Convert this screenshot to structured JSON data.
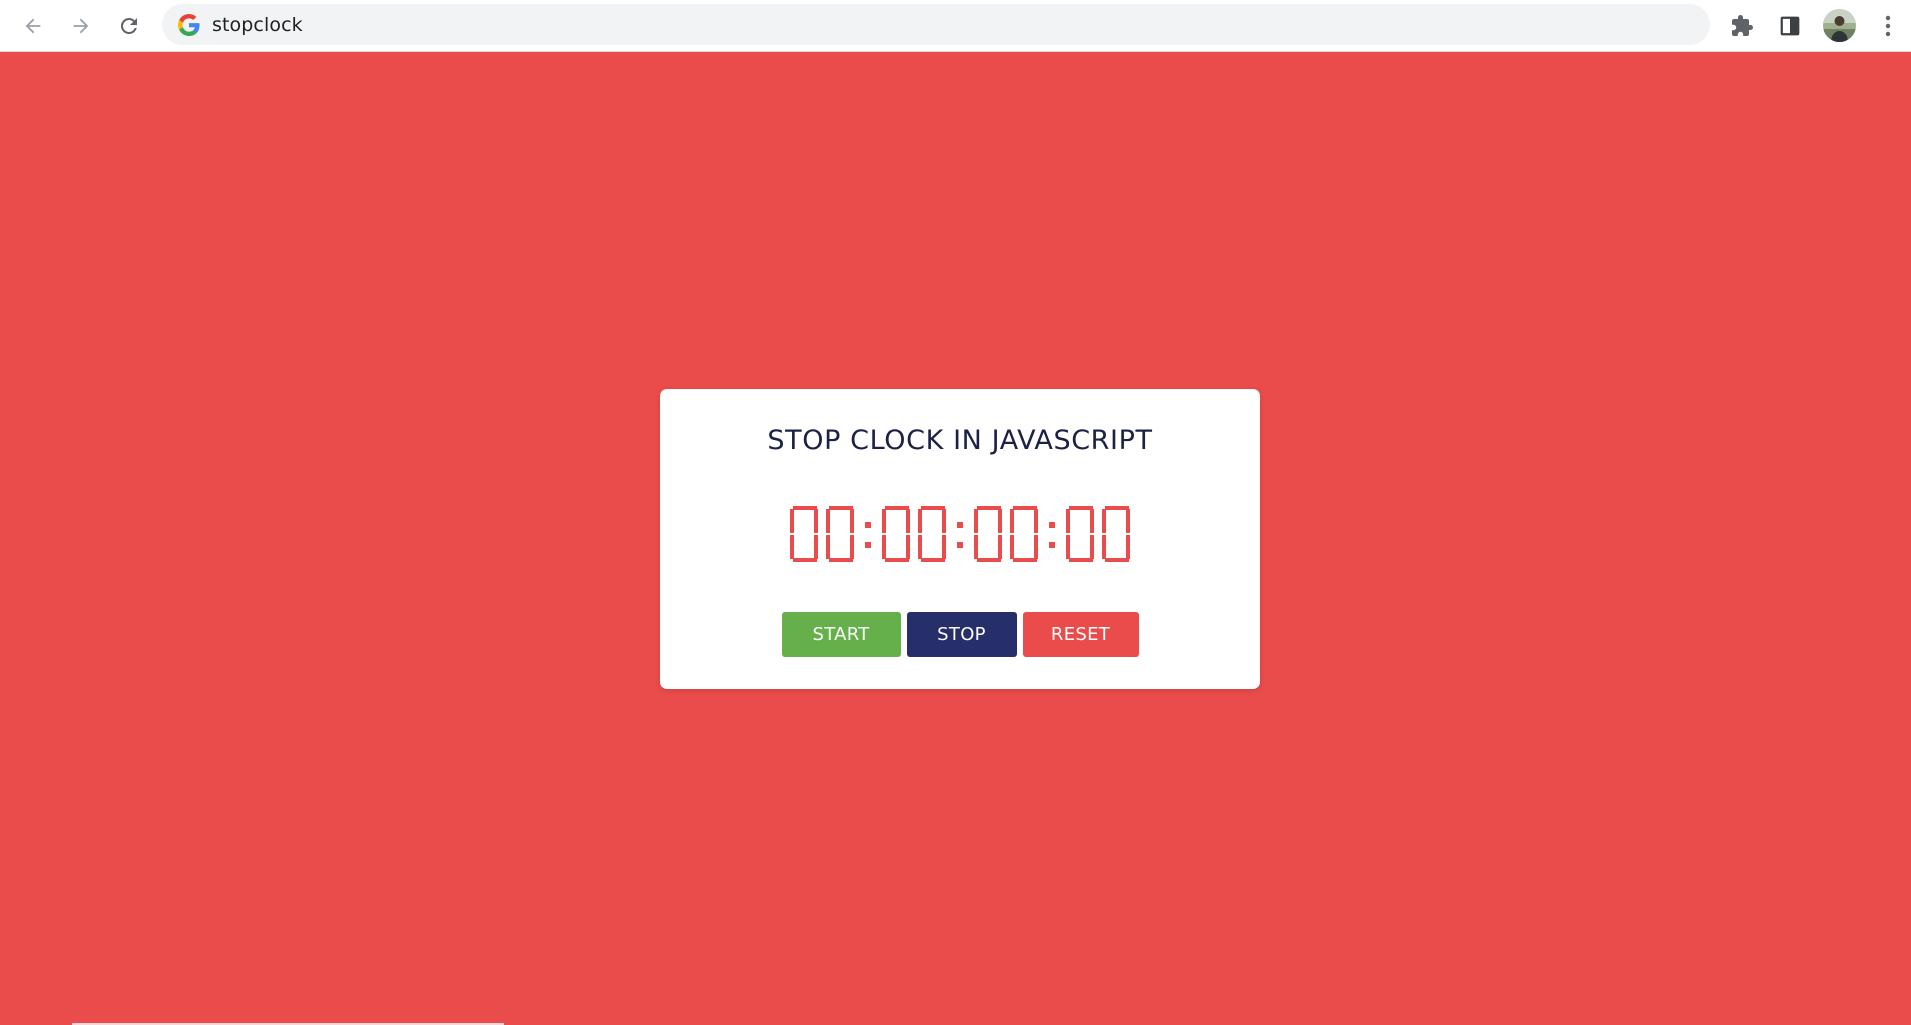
{
  "browser": {
    "url": "stopclock",
    "icons": {
      "back": "arrow-left-icon",
      "forward": "arrow-right-icon",
      "reload": "reload-icon",
      "site": "google-g-icon",
      "extensions": "puzzle-piece-icon",
      "side_panel": "side-panel-icon",
      "profile": "avatar",
      "menu": "kebab-menu-icon"
    }
  },
  "page": {
    "background_color": "#e94c4a",
    "title": "STOP CLOCK IN JAVASCRIPT",
    "display": {
      "hours": "00",
      "minutes": "00",
      "seconds": "00",
      "centiseconds": "00",
      "digit_color": "#e94c4a"
    },
    "buttons": {
      "start": "START",
      "stop": "STOP",
      "reset": "RESET"
    },
    "colors": {
      "start": "#66b04c",
      "stop": "#272f6b",
      "reset": "#e94c4a",
      "title": "#1c2244"
    }
  }
}
